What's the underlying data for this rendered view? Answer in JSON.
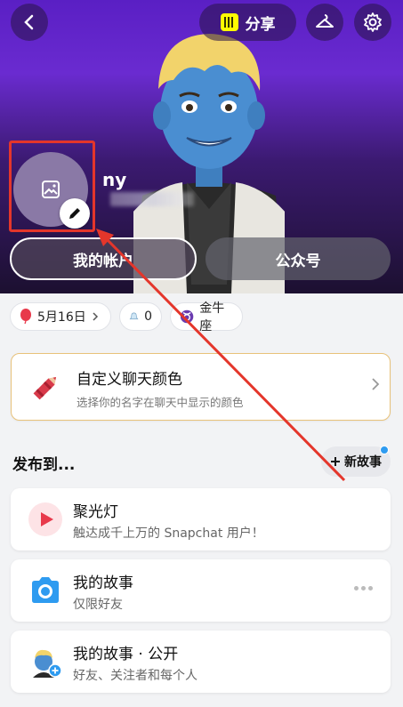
{
  "header": {
    "share_label": "分享",
    "username": "ny",
    "my_account_label": "我的帐户",
    "public_account_label": "公众号"
  },
  "info": {
    "birthday": "5月16日",
    "friends_count": "0",
    "zodiac": "金牛座"
  },
  "chat_color": {
    "title": "自定义聊天颜色",
    "subtitle": "选择你的名字在聊天中显示的颜色"
  },
  "post_to": {
    "section_title": "发布到...",
    "new_story_label": "新故事",
    "cards": [
      {
        "title": "聚光灯",
        "subtitle": "触达成千上万的 Snapchat 用户！"
      },
      {
        "title": "我的故事",
        "subtitle": "仅限好友"
      },
      {
        "title": "我的故事 · 公开",
        "subtitle": "好友、关注者和每个人"
      }
    ]
  },
  "colors": {
    "header_purple": "#5a1fc4",
    "annotation_red": "#e4362b",
    "spotlight_red": "#e8394b",
    "story_blue": "#2e9bf0",
    "card_border_gold": "#e8c27a"
  },
  "icons": [
    "back-icon",
    "snapcode-icon",
    "hanger-icon",
    "gear-icon",
    "photo-icon",
    "pencil-icon",
    "balloon-icon",
    "friends-icon",
    "zodiac-icon",
    "crayon-icon",
    "chevron-right-icon",
    "plus-icon",
    "play-icon",
    "camera-icon",
    "more-icon"
  ]
}
